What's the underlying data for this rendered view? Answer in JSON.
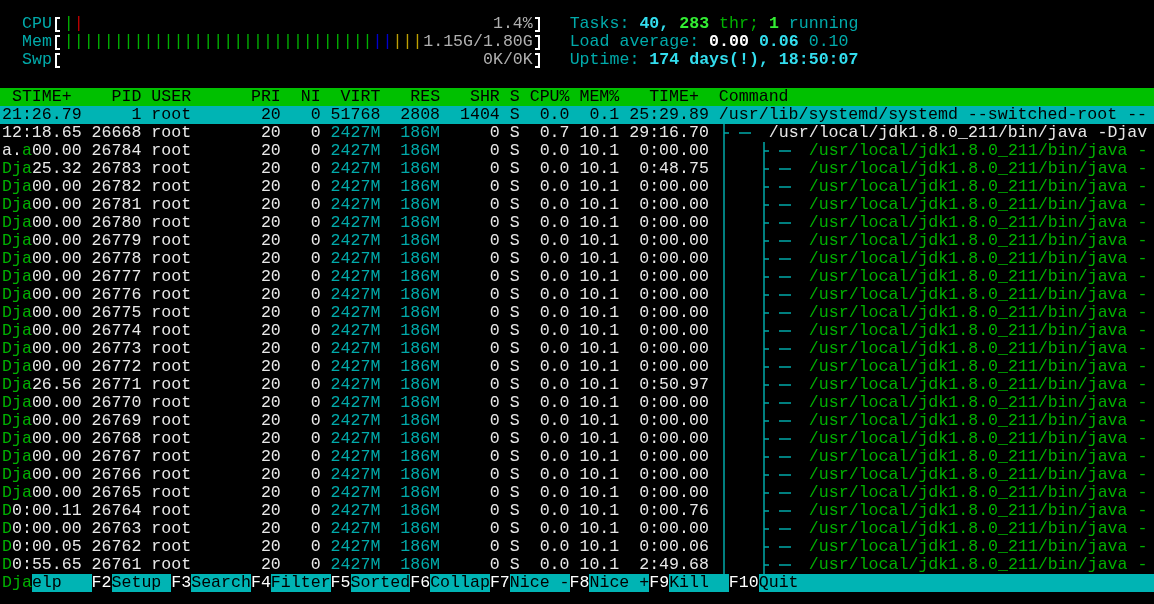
{
  "meters": [
    {
      "label": "CPU",
      "segments": [
        {
          "text": "|",
          "color": "#00b000"
        },
        {
          "text": "|",
          "color": "#c00000"
        }
      ],
      "reading": "1.4%"
    },
    {
      "label": "Mem",
      "segments": [
        {
          "text": "|||||||||||||||||||||||||||||||",
          "color": "#00b000"
        },
        {
          "text": "||",
          "color": "#0000d0"
        },
        {
          "text": "|||",
          "color": "#c0a000"
        }
      ],
      "reading": "1.15G/1.80G"
    },
    {
      "label": "Swp",
      "reading": "0K/0K"
    }
  ],
  "tasks": {
    "label": "Tasks:",
    "processes": "40,",
    "threads": "283",
    "threads_label": "thr;",
    "running": "1",
    "running_label": "running"
  },
  "load_average": {
    "label": "Load average:",
    "values": [
      "0.00",
      "0.06",
      "0.10"
    ]
  },
  "uptime": {
    "label": "Uptime:",
    "value": "174 days(!), 18:50:07"
  },
  "columns": [
    "STIME+",
    "PID",
    "USER",
    "PRI",
    "NI",
    "VIRT",
    "RES",
    "SHR",
    "S",
    "CPU%",
    "MEM%",
    "TIME+",
    "Command"
  ],
  "processes": [
    {
      "kind": "process",
      "selected": true,
      "stime": [
        {
          "text": "21:26.79",
          "glitch": false
        }
      ],
      "pid": "1",
      "user": "root",
      "pri": "20",
      "ni": "0",
      "virt": "51768",
      "res": "2808",
      "shr": "1404",
      "state": "S",
      "cpu": "0.0",
      "mem": "0.1",
      "time": "25:29.89",
      "command": "/usr/lib/systemd/systemd --switched-root --",
      "children": [
        {
          "kind": "process",
          "selected": false,
          "stime": [
            {
              "text": "12:18.65",
              "glitch": false
            }
          ],
          "pid": "26668",
          "user": "root",
          "pri": "20",
          "ni": "0",
          "virt": "2427M",
          "res": "186M",
          "shr": "0",
          "state": "S",
          "cpu": "0.7",
          "mem": "10.1",
          "time": "29:16.70",
          "command": "/usr/local/jdk1.8.0_211/bin/java -Djav",
          "children": [
            {
              "kind": "thread",
              "selected": false,
              "stime": [
                {
                  "text": "a.",
                  "glitch": false
                },
                {
                  "text": "a",
                  "glitch": true
                },
                {
                  "text": "00.00",
                  "glitch": false
                }
              ],
              "pid": "26784",
              "user": "root",
              "pri": "20",
              "ni": "0",
              "virt": "2427M",
              "res": "186M",
              "shr": "0",
              "state": "S",
              "cpu": "0.0",
              "mem": "10.1",
              "time": "0:00.00",
              "command": "/usr/local/jdk1.8.0_211/bin/java -"
            },
            {
              "kind": "thread",
              "selected": false,
              "stime": [
                {
                  "text": "Dja",
                  "glitch": true
                },
                {
                  "text": "25.32",
                  "glitch": false
                }
              ],
              "pid": "26783",
              "user": "root",
              "pri": "20",
              "ni": "0",
              "virt": "2427M",
              "res": "186M",
              "shr": "0",
              "state": "S",
              "cpu": "0.0",
              "mem": "10.1",
              "time": "0:48.75",
              "command": "/usr/local/jdk1.8.0_211/bin/java -"
            },
            {
              "kind": "thread",
              "selected": false,
              "stime": [
                {
                  "text": "Dja",
                  "glitch": true
                },
                {
                  "text": "00.00",
                  "glitch": false
                }
              ],
              "pid": "26782",
              "user": "root",
              "pri": "20",
              "ni": "0",
              "virt": "2427M",
              "res": "186M",
              "shr": "0",
              "state": "S",
              "cpu": "0.0",
              "mem": "10.1",
              "time": "0:00.00",
              "command": "/usr/local/jdk1.8.0_211/bin/java -"
            },
            {
              "kind": "thread",
              "selected": false,
              "stime": [
                {
                  "text": "Dja",
                  "glitch": true
                },
                {
                  "text": "00.00",
                  "glitch": false
                }
              ],
              "pid": "26781",
              "user": "root",
              "pri": "20",
              "ni": "0",
              "virt": "2427M",
              "res": "186M",
              "shr": "0",
              "state": "S",
              "cpu": "0.0",
              "mem": "10.1",
              "time": "0:00.00",
              "command": "/usr/local/jdk1.8.0_211/bin/java -"
            },
            {
              "kind": "thread",
              "selected": false,
              "stime": [
                {
                  "text": "Dja",
                  "glitch": true
                },
                {
                  "text": "00.00",
                  "glitch": false
                }
              ],
              "pid": "26780",
              "user": "root",
              "pri": "20",
              "ni": "0",
              "virt": "2427M",
              "res": "186M",
              "shr": "0",
              "state": "S",
              "cpu": "0.0",
              "mem": "10.1",
              "time": "0:00.00",
              "command": "/usr/local/jdk1.8.0_211/bin/java -"
            },
            {
              "kind": "thread",
              "selected": false,
              "stime": [
                {
                  "text": "Dja",
                  "glitch": true
                },
                {
                  "text": "00.00",
                  "glitch": false
                }
              ],
              "pid": "26779",
              "user": "root",
              "pri": "20",
              "ni": "0",
              "virt": "2427M",
              "res": "186M",
              "shr": "0",
              "state": "S",
              "cpu": "0.0",
              "mem": "10.1",
              "time": "0:00.00",
              "command": "/usr/local/jdk1.8.0_211/bin/java -"
            },
            {
              "kind": "thread",
              "selected": false,
              "stime": [
                {
                  "text": "Dja",
                  "glitch": true
                },
                {
                  "text": "00.00",
                  "glitch": false
                }
              ],
              "pid": "26778",
              "user": "root",
              "pri": "20",
              "ni": "0",
              "virt": "2427M",
              "res": "186M",
              "shr": "0",
              "state": "S",
              "cpu": "0.0",
              "mem": "10.1",
              "time": "0:00.00",
              "command": "/usr/local/jdk1.8.0_211/bin/java -"
            },
            {
              "kind": "thread",
              "selected": false,
              "stime": [
                {
                  "text": "Dja",
                  "glitch": true
                },
                {
                  "text": "00.00",
                  "glitch": false
                }
              ],
              "pid": "26777",
              "user": "root",
              "pri": "20",
              "ni": "0",
              "virt": "2427M",
              "res": "186M",
              "shr": "0",
              "state": "S",
              "cpu": "0.0",
              "mem": "10.1",
              "time": "0:00.00",
              "command": "/usr/local/jdk1.8.0_211/bin/java -"
            },
            {
              "kind": "thread",
              "selected": false,
              "stime": [
                {
                  "text": "Dja",
                  "glitch": true
                },
                {
                  "text": "00.00",
                  "glitch": false
                }
              ],
              "pid": "26776",
              "user": "root",
              "pri": "20",
              "ni": "0",
              "virt": "2427M",
              "res": "186M",
              "shr": "0",
              "state": "S",
              "cpu": "0.0",
              "mem": "10.1",
              "time": "0:00.00",
              "command": "/usr/local/jdk1.8.0_211/bin/java -"
            },
            {
              "kind": "thread",
              "selected": false,
              "stime": [
                {
                  "text": "Dja",
                  "glitch": true
                },
                {
                  "text": "00.00",
                  "glitch": false
                }
              ],
              "pid": "26775",
              "user": "root",
              "pri": "20",
              "ni": "0",
              "virt": "2427M",
              "res": "186M",
              "shr": "0",
              "state": "S",
              "cpu": "0.0",
              "mem": "10.1",
              "time": "0:00.00",
              "command": "/usr/local/jdk1.8.0_211/bin/java -"
            },
            {
              "kind": "thread",
              "selected": false,
              "stime": [
                {
                  "text": "Dja",
                  "glitch": true
                },
                {
                  "text": "00.00",
                  "glitch": false
                }
              ],
              "pid": "26774",
              "user": "root",
              "pri": "20",
              "ni": "0",
              "virt": "2427M",
              "res": "186M",
              "shr": "0",
              "state": "S",
              "cpu": "0.0",
              "mem": "10.1",
              "time": "0:00.00",
              "command": "/usr/local/jdk1.8.0_211/bin/java -"
            },
            {
              "kind": "thread",
              "selected": false,
              "stime": [
                {
                  "text": "Dja",
                  "glitch": true
                },
                {
                  "text": "00.00",
                  "glitch": false
                }
              ],
              "pid": "26773",
              "user": "root",
              "pri": "20",
              "ni": "0",
              "virt": "2427M",
              "res": "186M",
              "shr": "0",
              "state": "S",
              "cpu": "0.0",
              "mem": "10.1",
              "time": "0:00.00",
              "command": "/usr/local/jdk1.8.0_211/bin/java -"
            },
            {
              "kind": "thread",
              "selected": false,
              "stime": [
                {
                  "text": "Dja",
                  "glitch": true
                },
                {
                  "text": "00.00",
                  "glitch": false
                }
              ],
              "pid": "26772",
              "user": "root",
              "pri": "20",
              "ni": "0",
              "virt": "2427M",
              "res": "186M",
              "shr": "0",
              "state": "S",
              "cpu": "0.0",
              "mem": "10.1",
              "time": "0:00.00",
              "command": "/usr/local/jdk1.8.0_211/bin/java -"
            },
            {
              "kind": "thread",
              "selected": false,
              "stime": [
                {
                  "text": "Dja",
                  "glitch": true
                },
                {
                  "text": "26.56",
                  "glitch": false
                }
              ],
              "pid": "26771",
              "user": "root",
              "pri": "20",
              "ni": "0",
              "virt": "2427M",
              "res": "186M",
              "shr": "0",
              "state": "S",
              "cpu": "0.0",
              "mem": "10.1",
              "time": "0:50.97",
              "command": "/usr/local/jdk1.8.0_211/bin/java -"
            },
            {
              "kind": "thread",
              "selected": false,
              "stime": [
                {
                  "text": "Dja",
                  "glitch": true
                },
                {
                  "text": "00.00",
                  "glitch": false
                }
              ],
              "pid": "26770",
              "user": "root",
              "pri": "20",
              "ni": "0",
              "virt": "2427M",
              "res": "186M",
              "shr": "0",
              "state": "S",
              "cpu": "0.0",
              "mem": "10.1",
              "time": "0:00.00",
              "command": "/usr/local/jdk1.8.0_211/bin/java -"
            },
            {
              "kind": "thread",
              "selected": false,
              "stime": [
                {
                  "text": "Dja",
                  "glitch": true
                },
                {
                  "text": "00.00",
                  "glitch": false
                }
              ],
              "pid": "26769",
              "user": "root",
              "pri": "20",
              "ni": "0",
              "virt": "2427M",
              "res": "186M",
              "shr": "0",
              "state": "S",
              "cpu": "0.0",
              "mem": "10.1",
              "time": "0:00.00",
              "command": "/usr/local/jdk1.8.0_211/bin/java -"
            },
            {
              "kind": "thread",
              "selected": false,
              "stime": [
                {
                  "text": "Dja",
                  "glitch": true
                },
                {
                  "text": "00.00",
                  "glitch": false
                }
              ],
              "pid": "26768",
              "user": "root",
              "pri": "20",
              "ni": "0",
              "virt": "2427M",
              "res": "186M",
              "shr": "0",
              "state": "S",
              "cpu": "0.0",
              "mem": "10.1",
              "time": "0:00.00",
              "command": "/usr/local/jdk1.8.0_211/bin/java -"
            },
            {
              "kind": "thread",
              "selected": false,
              "stime": [
                {
                  "text": "Dja",
                  "glitch": true
                },
                {
                  "text": "00.00",
                  "glitch": false
                }
              ],
              "pid": "26767",
              "user": "root",
              "pri": "20",
              "ni": "0",
              "virt": "2427M",
              "res": "186M",
              "shr": "0",
              "state": "S",
              "cpu": "0.0",
              "mem": "10.1",
              "time": "0:00.00",
              "command": "/usr/local/jdk1.8.0_211/bin/java -"
            },
            {
              "kind": "thread",
              "selected": false,
              "stime": [
                {
                  "text": "Dja",
                  "glitch": true
                },
                {
                  "text": "00.00",
                  "glitch": false
                }
              ],
              "pid": "26766",
              "user": "root",
              "pri": "20",
              "ni": "0",
              "virt": "2427M",
              "res": "186M",
              "shr": "0",
              "state": "S",
              "cpu": "0.0",
              "mem": "10.1",
              "time": "0:00.00",
              "command": "/usr/local/jdk1.8.0_211/bin/java -"
            },
            {
              "kind": "thread",
              "selected": false,
              "stime": [
                {
                  "text": "Dja",
                  "glitch": true
                },
                {
                  "text": "00.00",
                  "glitch": false
                }
              ],
              "pid": "26765",
              "user": "root",
              "pri": "20",
              "ni": "0",
              "virt": "2427M",
              "res": "186M",
              "shr": "0",
              "state": "S",
              "cpu": "0.0",
              "mem": "10.1",
              "time": "0:00.00",
              "command": "/usr/local/jdk1.8.0_211/bin/java -"
            },
            {
              "kind": "thread",
              "selected": false,
              "stime": [
                {
                  "text": "D",
                  "glitch": true
                },
                {
                  "text": "0:00.11",
                  "glitch": false
                }
              ],
              "pid": "26764",
              "user": "root",
              "pri": "20",
              "ni": "0",
              "virt": "2427M",
              "res": "186M",
              "shr": "0",
              "state": "S",
              "cpu": "0.0",
              "mem": "10.1",
              "time": "0:00.76",
              "command": "/usr/local/jdk1.8.0_211/bin/java -"
            },
            {
              "kind": "thread",
              "selected": false,
              "stime": [
                {
                  "text": "D",
                  "glitch": true
                },
                {
                  "text": "0:00.00",
                  "glitch": false
                }
              ],
              "pid": "26763",
              "user": "root",
              "pri": "20",
              "ni": "0",
              "virt": "2427M",
              "res": "186M",
              "shr": "0",
              "state": "S",
              "cpu": "0.0",
              "mem": "10.1",
              "time": "0:00.00",
              "command": "/usr/local/jdk1.8.0_211/bin/java -"
            },
            {
              "kind": "thread",
              "selected": false,
              "stime": [
                {
                  "text": "D",
                  "glitch": true
                },
                {
                  "text": "0:00.05",
                  "glitch": false
                }
              ],
              "pid": "26762",
              "user": "root",
              "pri": "20",
              "ni": "0",
              "virt": "2427M",
              "res": "186M",
              "shr": "0",
              "state": "S",
              "cpu": "0.0",
              "mem": "10.1",
              "time": "0:00.06",
              "command": "/usr/local/jdk1.8.0_211/bin/java -"
            },
            {
              "kind": "thread",
              "selected": false,
              "stime": [
                {
                  "text": "D",
                  "glitch": true
                },
                {
                  "text": "0:55.65",
                  "glitch": false
                }
              ],
              "pid": "26761",
              "user": "root",
              "pri": "20",
              "ni": "0",
              "virt": "2427M",
              "res": "186M",
              "shr": "0",
              "state": "S",
              "cpu": "0.0",
              "mem": "10.1",
              "time": "2:49.68",
              "command": "/usr/local/jdk1.8.0_211/bin/java -"
            }
          ]
        }
      ]
    }
  ],
  "function_keys": [
    {
      "key": "Dja",
      "glitch": true,
      "label": "elp"
    },
    {
      "key": "F2",
      "glitch": false,
      "label": "Setup"
    },
    {
      "key": "F3",
      "glitch": false,
      "label": "Search"
    },
    {
      "key": "F4",
      "glitch": false,
      "label": "Filter"
    },
    {
      "key": "F5",
      "glitch": false,
      "label": "Sorted"
    },
    {
      "key": "F6",
      "glitch": false,
      "label": "Collap"
    },
    {
      "key": "F7",
      "glitch": false,
      "label": "Nice -"
    },
    {
      "key": "F8",
      "glitch": false,
      "label": "Nice +"
    },
    {
      "key": "F9",
      "glitch": false,
      "label": "Kill"
    },
    {
      "key": "F10",
      "glitch": false,
      "label": "Quit"
    }
  ]
}
